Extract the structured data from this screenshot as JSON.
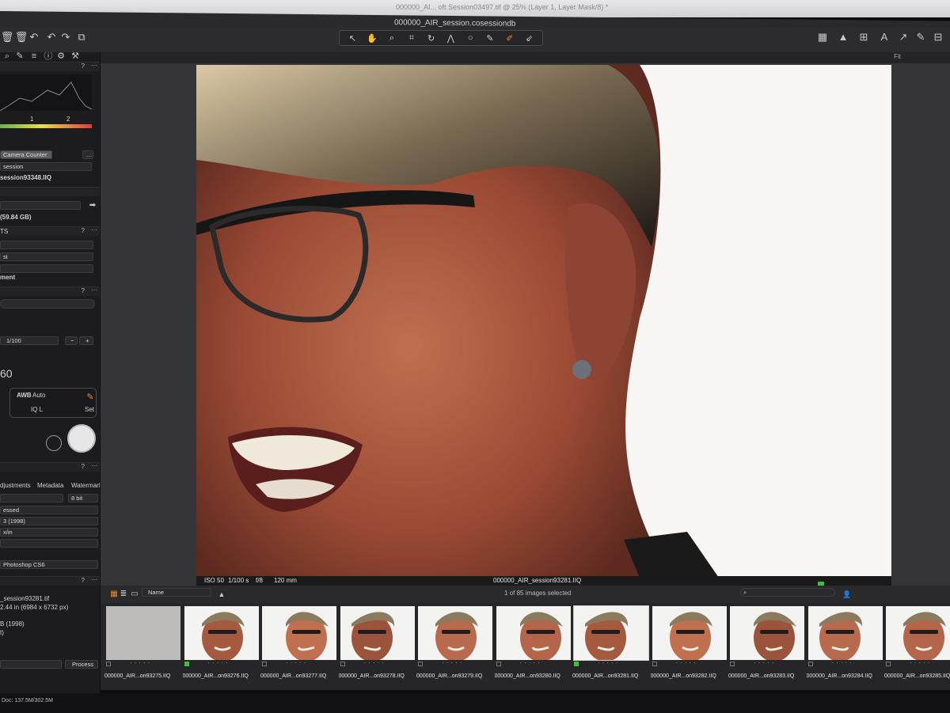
{
  "background_window": {
    "tab_text": "000000_AI... oft Session03497.tif @ 25% (Layer 1, Layer Mask/8) *"
  },
  "window": {
    "title": "000000_AIR_session.cosessiondb"
  },
  "viewer": {
    "fit_label": "Fit"
  },
  "left_panel": {
    "histogram_ticks": [
      "1",
      "2"
    ],
    "camera_counter_tab": "Camera Counter",
    "session_label": "session",
    "file_label": "session93348.IIQ",
    "storage": "(59.84 GB)",
    "ts_label": "TS",
    "st_label": "st",
    "ment_label": "ment",
    "shutter_value": "1/100",
    "iso_partial": "60",
    "wb_label": "AWB",
    "wb_value": "Auto",
    "format_label": "IQ L",
    "set_label": "Set",
    "tabs": [
      "djustments",
      "Metadata",
      "Watermark"
    ],
    "bit_depth": "8 bit",
    "rows": [
      "essed",
      "3 (1998)",
      "x/in"
    ],
    "profile": "Photoshop CS6",
    "output_file": "_session93281.tif",
    "dimensions": "2.44 in (6984 x 6732 px)",
    "color_space": "B (1998)",
    "extra": "t)",
    "process_button": "Process"
  },
  "info_strip": {
    "iso": "ISO 50",
    "shutter": "1/100 s",
    "aperture": "f/8",
    "focal": "120 mm",
    "filename": "000000_AIR_session93281.IIQ"
  },
  "browser_bar": {
    "sort_by": "Name",
    "selection_status": "1 of 85 images selected"
  },
  "filmstrip": [
    {
      "name": "000000_AIR...on93275.IIQ",
      "tag": false
    },
    {
      "name": "000000_AIR...on93276.IIQ",
      "tag": true
    },
    {
      "name": "000000_AIR...on93277.IIQ",
      "tag": false
    },
    {
      "name": "000000_AIR...on93278.IIQ",
      "tag": false
    },
    {
      "name": "000000_AIR...on93279.IIQ",
      "tag": false
    },
    {
      "name": "000000_AIR...on93280.IIQ",
      "tag": false
    },
    {
      "name": "000000_AIR...on93281.IIQ",
      "tag": true,
      "selected": true
    },
    {
      "name": "000000_AIR...on93282.IIQ",
      "tag": false
    },
    {
      "name": "000000_AIR...on93283.IIQ",
      "tag": false
    },
    {
      "name": "000000_AIR...on93284.IIQ",
      "tag": false
    },
    {
      "name": "000000_AIR...on93285.IIQ",
      "tag": false
    }
  ],
  "dock": {
    "doc_status": "Doc: 137.5M/302.5M"
  },
  "colors": {
    "accent_orange": "#f08a2c",
    "green_tag": "#3bc23b"
  }
}
